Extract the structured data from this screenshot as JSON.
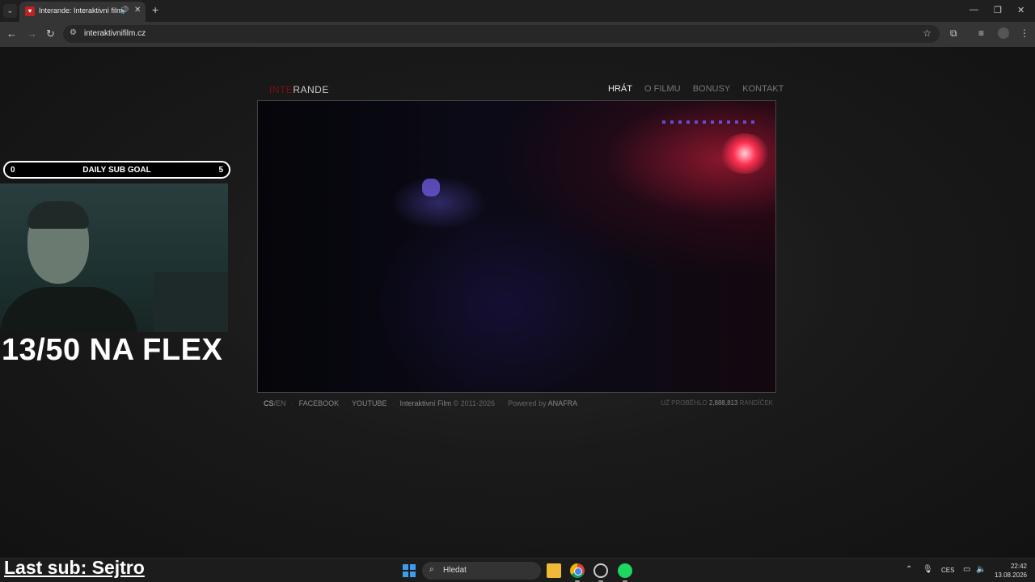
{
  "browser": {
    "tab_title": "Interande: Interaktivní film,",
    "url": "interaktivnifilm.cz",
    "tab_list_icon": "chevron-down",
    "new_tab_icon": "plus"
  },
  "site": {
    "logo_red": "INTE",
    "logo_white": "RANDE",
    "nav": [
      "HRÁT",
      "O FILMU",
      "BONUSY",
      "KONTAKT"
    ],
    "nav_active": "HRÁT",
    "footer": {
      "lang_cs": "CS",
      "lang_sep": "/",
      "lang_en": "EN",
      "facebook": "FACEBOOK",
      "youtube": "YOUTUBE",
      "copyright_name": "Interaktivní Film",
      "copyright_years": "© 2011-2026",
      "powered_by": "Powered by",
      "powered_name": "ANAFRA",
      "counter_prefix": "UŽ PROBĚHLO",
      "counter_value": "2,888,813",
      "counter_suffix": "RANDÍČEK"
    }
  },
  "overlay": {
    "goal_min": "0",
    "goal_label": "DAILY SUB GOAL",
    "goal_max": "5",
    "flex_text": "13/50 NA FLEX",
    "last_sub": "Last sub: Sejtro"
  },
  "taskbar": {
    "search_placeholder": "Hledat",
    "language": "CES",
    "time": "22:42",
    "date": "13.08.2026"
  },
  "colors": {
    "logo_red": "#7a1010",
    "windows_blue": "#3b9cf0",
    "spotify_green": "#1ed760"
  }
}
